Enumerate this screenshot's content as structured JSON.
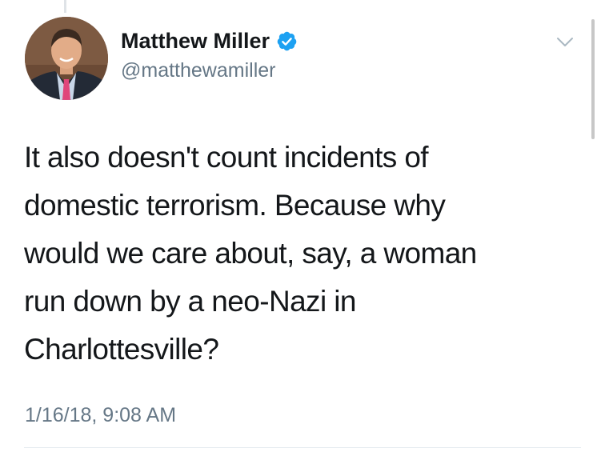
{
  "tweet": {
    "author": {
      "display_name": "Matthew Miller",
      "handle": "@matthewamiller",
      "verified": true,
      "avatar_icon": "profile-photo"
    },
    "text": "It also doesn't count incidents of\ndomestic terrorism. Because why\nwould we care about, say, a woman\nrun down by a neo-Nazi in\nCharlottesville?",
    "timestamp": "1/16/18, 9:08 AM",
    "menu_icon": "chevron-down-icon"
  },
  "colors": {
    "verified_badge": "#1da1f2",
    "secondary_text": "#657786",
    "primary_text": "#14171a",
    "divider": "#e6ecf0"
  }
}
